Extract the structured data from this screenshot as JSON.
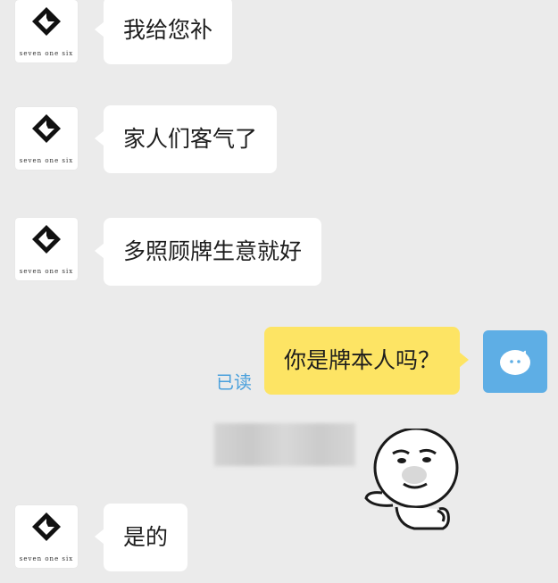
{
  "messages": [
    {
      "sender": "seven one six",
      "side": "incoming",
      "text": "我给您补"
    },
    {
      "sender": "seven one six",
      "side": "incoming",
      "text": "家人们客气了"
    },
    {
      "sender": "seven one six",
      "side": "incoming",
      "text": "多照顾牌生意就好"
    },
    {
      "sender": "self",
      "side": "outgoing",
      "text": "你是牌本人吗？",
      "status": "已读"
    },
    {
      "sender": "seven one six",
      "side": "incoming",
      "text": "是的"
    }
  ],
  "contact": {
    "logo_text": "seven one six"
  },
  "colors": {
    "background": "#ebebeb",
    "incoming_bubble": "#ffffff",
    "outgoing_bubble": "#fde464",
    "read_receipt": "#4aa0dc",
    "self_avatar": "#5eaee5"
  },
  "icons": {
    "contact_avatar": "seven-one-six-logo-icon",
    "self_avatar": "qq-penguin-icon",
    "sticker": "panda-face-meme-sticker"
  }
}
